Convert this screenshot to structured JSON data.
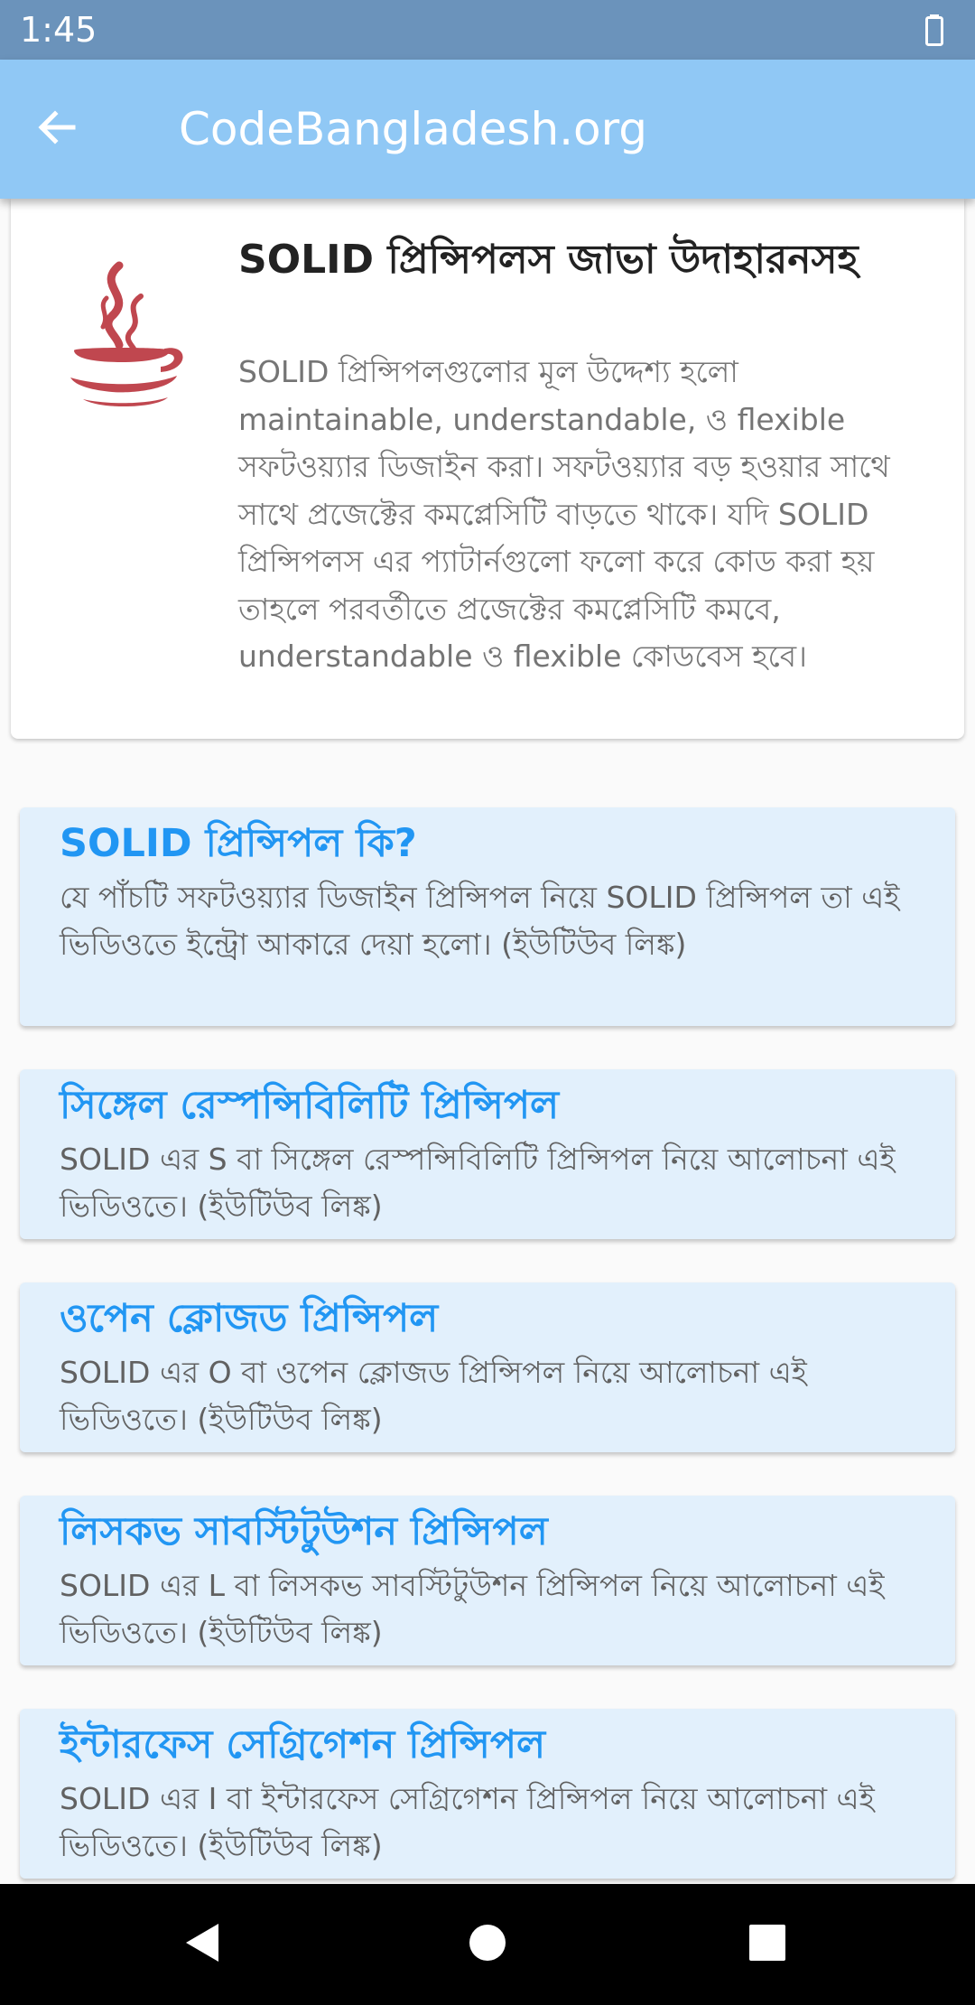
{
  "status_bar": {
    "time": "1:45",
    "battery_icon": "battery-icon"
  },
  "app_bar": {
    "back_icon": "arrow-back-icon",
    "title": "CodeBangladesh.org"
  },
  "header_card": {
    "icon": "java-coffee-cup-icon",
    "title": "SOLID প্রিন্সিপলস জাভা উদাহারনসহ",
    "description": "SOLID প্রিন্সিপলগুলোর মূল উদ্দেশ্য হলো maintainable, understandable, ও flexible সফটওয়্যার ডিজাইন করা। সফটওয়্যার বড় হওয়ার সাথে সাথে প্রজেক্টের কমপ্লেসিটি বাড়তে থাকে। যদি SOLID প্রিন্সিপলস এর প্যাটার্নগুলো ফলো করে কোড করা হয় তাহলে পরবর্তীতে প্রজেক্টের কমপ্লেসিটি কমবে, understandable ও flexible কোডবেস হবে।"
  },
  "lessons": [
    {
      "title": "SOLID প্রিন্সিপল কি?",
      "description": "যে পাঁচটি সফটওয়্যার ডিজাইন প্রিন্সিপল নিয়ে SOLID প্রিন্সিপল তা এই ভিডিওতে ইন্ট্রো আকারে দেয়া হলো। (ইউটিউব লিঙ্ক)"
    },
    {
      "title": "সিঙ্গেল রেস্পন্সিবিলিটি প্রিন্সিপল",
      "description": "SOLID এর S বা সিঙ্গেল রেস্পন্সিবিলিটি প্রিন্সিপল নিয়ে আলোচনা এই ভিডিওতে। (ইউটিউব লিঙ্ক)"
    },
    {
      "title": "ওপেন ক্লোজড প্রিন্সিপল",
      "description": "SOLID এর O বা ওপেন ক্লোজড প্রিন্সিপল নিয়ে আলোচনা এই ভিডিওতে। (ইউটিউব লিঙ্ক)"
    },
    {
      "title": "লিসকভ সাবস্টিটুউশন প্রিন্সিপল",
      "description": "SOLID এর L বা লিসকভ সাবস্টিটুউশন প্রিন্সিপল নিয়ে আলোচনা এই ভিডিওতে। (ইউটিউব লিঙ্ক)"
    },
    {
      "title": "ইন্টারফেস সেগ্রিগেশন প্রিন্সিপল",
      "description": "SOLID এর I বা ইন্টারফেস সেগ্রিগেশন প্রিন্সিপল নিয়ে আলোচনা এই ভিডিওতে। (ইউটিউব লিঙ্ক)"
    }
  ],
  "nav_bar": {
    "back_icon": "nav-back-icon",
    "home_icon": "nav-home-icon",
    "recents_icon": "nav-recents-icon"
  },
  "colors": {
    "status_bar": "#6b93bb",
    "app_bar": "#90c8f5",
    "card_background": "#e2f0fc",
    "lesson_title": "#2196f3",
    "java_icon": "#c0474f"
  }
}
